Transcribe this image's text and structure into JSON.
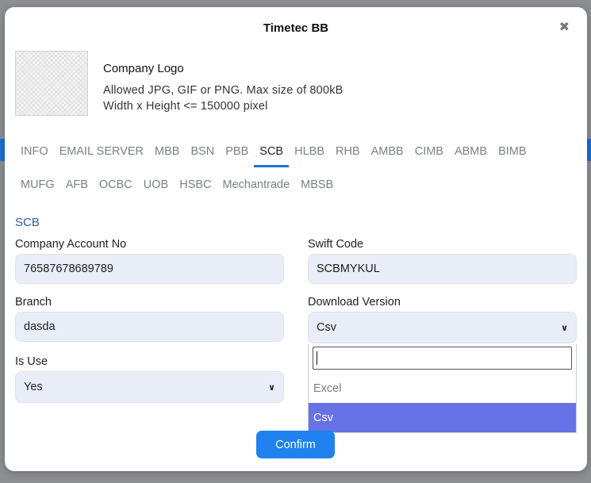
{
  "modal": {
    "title": "Timetec BB",
    "close_icon": "close-icon"
  },
  "logo": {
    "title": "Company Logo",
    "desc_line1": "Allowed JPG, GIF or PNG. Max size of 800kB",
    "desc_line2": "Width x Height <= 150000 pixel"
  },
  "tabs_row1": [
    "INFO",
    "EMAIL SERVER",
    "MBB",
    "BSN",
    "PBB",
    "SCB",
    "HLBB",
    "RHB",
    "AMBB",
    "CIMB",
    "ABMB",
    "BIMB"
  ],
  "tabs_row2": [
    "MUFG",
    "AFB",
    "OCBC",
    "UOB",
    "HSBC",
    "Mechantrade",
    "MBSB"
  ],
  "active_tab": "SCB",
  "form": {
    "section_title": "SCB",
    "account_label": "Company Account No",
    "account_value": "76587678689789",
    "swift_label": "Swift Code",
    "swift_value": "SCBMYKUL",
    "branch_label": "Branch",
    "branch_value": "dasda",
    "version_label": "Download Version",
    "version_value": "Csv",
    "isuse_label": "Is Use",
    "isuse_value": "Yes"
  },
  "dropdown": {
    "search_value": "",
    "options": [
      "Excel",
      "Csv"
    ],
    "selected": "Csv"
  },
  "confirm_label": "Confirm",
  "colors": {
    "accent": "#1f6fd0",
    "confirm": "#1f82ee",
    "field_bg": "#e8edf7",
    "selected_option": "#6672e6",
    "section_title": "#2a5aa8"
  }
}
